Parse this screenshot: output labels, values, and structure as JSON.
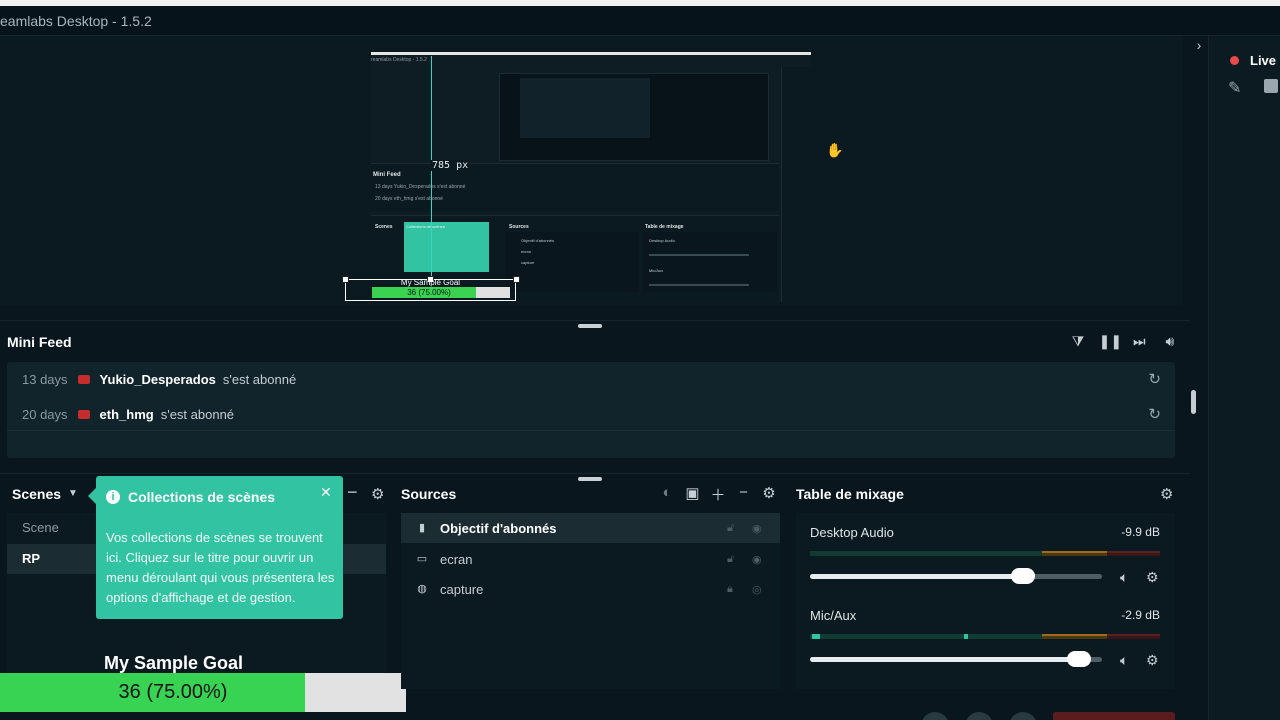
{
  "window": {
    "title": "eamlabs Desktop - 1.5.2"
  },
  "right_panel": {
    "live_label": "Live ("
  },
  "preview": {
    "measure_label": "785 px",
    "nested": {
      "title": "reamlabs Desktop - 1.5.2",
      "feed_title": "Mini Feed",
      "row1": "13 days  Yukio_Desperados  s'est abonné",
      "row2": "20 days  eth_hmg  s'est abonné",
      "scenes": "Scenes",
      "sources": "Sources",
      "mixer": "Table de mixage",
      "tip_title": "Collections de scènes",
      "src1": "Objectif d'abonnés",
      "src2": "ecran",
      "src3": "capture",
      "mix1": "Desktop Audio",
      "mix2": "Mic/Aux"
    },
    "goal_title": "My Sample Goal",
    "goal_value": "36 (75.00%)",
    "goal_progress": 0.75
  },
  "mini_feed": {
    "title": "Mini Feed",
    "tools": {
      "filter_icon": "filter-icon",
      "pause_icon": "pause-icon",
      "skip_icon": "skip-icon",
      "volume_icon": "volume-icon"
    },
    "rows": [
      {
        "days": "13 days",
        "user": "Yukio_Desperados",
        "action": "s'est abonné"
      },
      {
        "days": "20 days",
        "user": "eth_hmg",
        "action": "s'est abonné"
      }
    ]
  },
  "scenes": {
    "title": "Scenes",
    "items": [
      {
        "label": "Scene"
      },
      {
        "label": "RP"
      }
    ],
    "tooltip": {
      "title": "Collections de scènes",
      "body": "Vos collections de scènes se trouvent ici. Cliquez sur le titre pour ouvrir un menu déroulant qui vous présentera les options d'affichage et de gestion."
    }
  },
  "goal": {
    "title": "My Sample Goal",
    "value": "36 (75.00%)",
    "progress": 0.75
  },
  "sources": {
    "title": "Sources",
    "items": [
      {
        "label": "Objectif d'abonnés",
        "icon": "goal-icon"
      },
      {
        "label": "ecran",
        "icon": "monitor-icon"
      },
      {
        "label": "capture",
        "icon": "gamepad-icon"
      }
    ]
  },
  "mixer": {
    "title": "Table de mixage",
    "channels": [
      {
        "name": "Desktop Audio",
        "db": "-9.9 dB",
        "volume": 0.73
      },
      {
        "name": "Mic/Aux",
        "db": "-2.9 dB",
        "volume": 0.92
      }
    ]
  },
  "colors": {
    "accent": "#31c3a2",
    "goal_fill": "#39d353",
    "live": "#e84a4a",
    "bg": "#09161d"
  }
}
